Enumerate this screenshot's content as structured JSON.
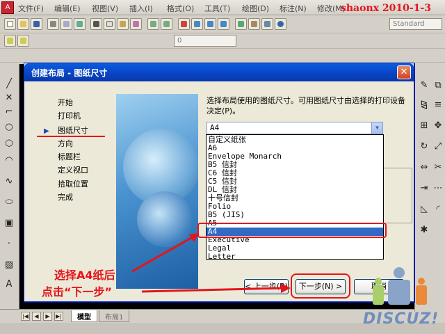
{
  "menubar": {
    "items": [
      "文件(F)",
      "编辑(E)",
      "视图(V)",
      "插入(I)",
      "格式(O)",
      "工具(T)",
      "绘图(D)",
      "标注(N)",
      "修改(M)"
    ]
  },
  "stamp": "shaonx 2010-1-3",
  "toolbar": {
    "style_combo": "Standard",
    "layer_combo": "0"
  },
  "tabs": {
    "model": "模型",
    "layout1": "布局1"
  },
  "dialog": {
    "title": "创建布局 - 图纸尺寸",
    "close": "✕",
    "steps": [
      "开始",
      "打印机",
      "图纸尺寸",
      "方向",
      "标题栏",
      "定义视口",
      "拾取位置",
      "完成"
    ],
    "current_step": "图纸尺寸",
    "prompt": "选择布局使用的图纸尺寸。可用图纸尺寸由选择的打印设备决定(P)。",
    "combo_value": "A4",
    "options": [
      "自定义纸张",
      "A6",
      "Envelope Monarch",
      "B5 信封",
      "C6 信封",
      "C5 信封",
      "DL 信封",
      "十号信封",
      "Folio",
      "B5 (JIS)",
      "A5",
      "A4",
      "Executive",
      "Legal",
      "Letter"
    ],
    "selected_option": "A4",
    "buttons": {
      "back": "< 上一步(B)",
      "next": "下一步(N) >",
      "cancel": "取消"
    }
  },
  "annotations": {
    "line1": "选择A4纸后",
    "line2": "点击“下一步”"
  },
  "watermark": {
    "text": "DISCUZ!"
  },
  "colors": {
    "accent_red": "#e4141b",
    "titlebar_blue": "#0a46c8",
    "selection_blue": "#316ac5"
  }
}
